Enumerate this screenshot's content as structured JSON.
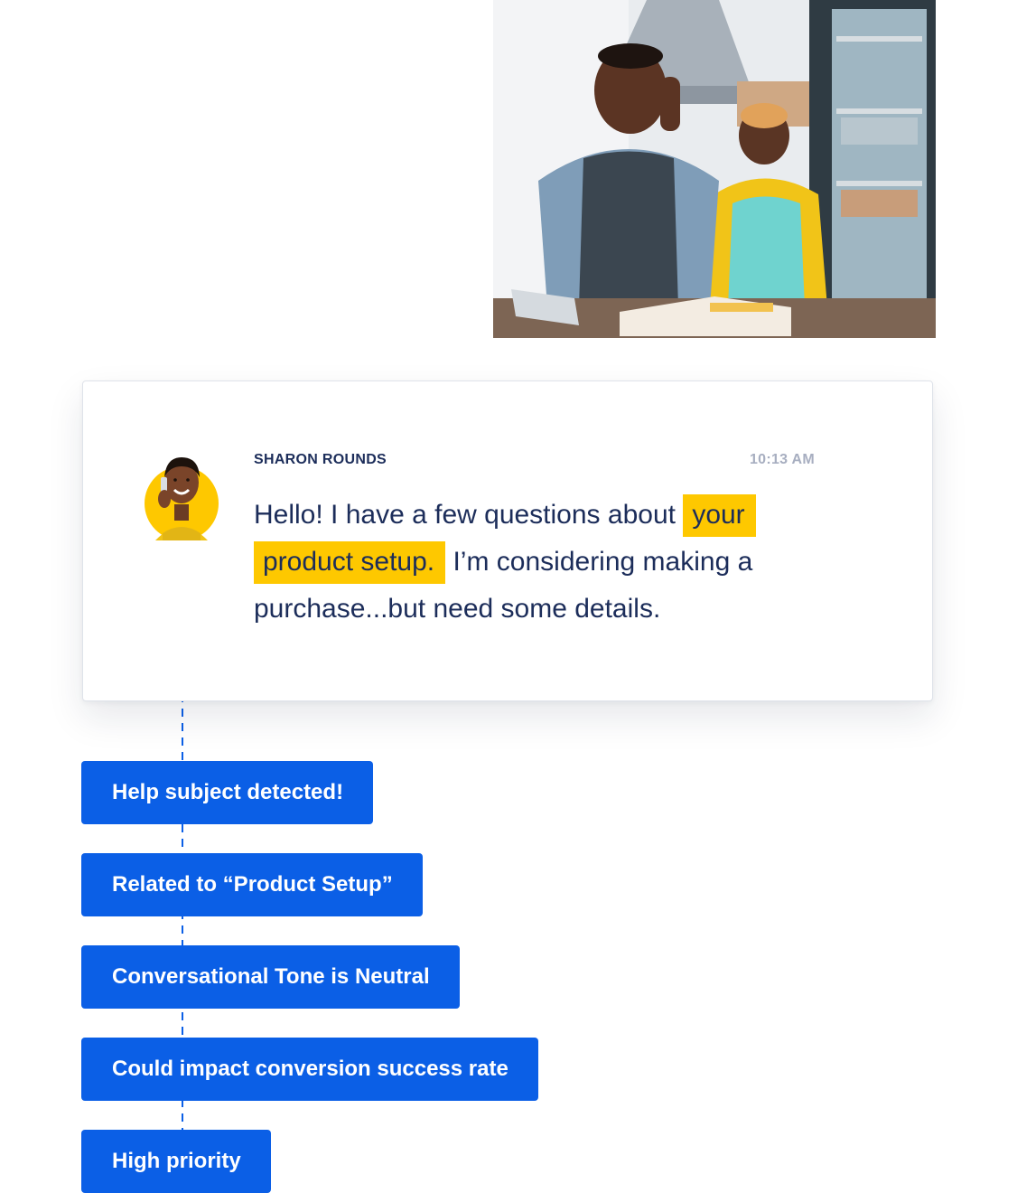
{
  "photo": {
    "icon": "cafe-workers-photo"
  },
  "message": {
    "sender": "SHARON ROUNDS",
    "time": "10:13 AM",
    "text_before": "Hello! I have a few questions about ",
    "highlight": "your product setup.",
    "text_after": " I’m considering making a purchase...but need some details.",
    "highlight_color": "#fec800"
  },
  "tags": [
    {
      "label": "Help subject detected!"
    },
    {
      "label": "Related to “Product Setup”"
    },
    {
      "label": "Conversational Tone is Neutral"
    },
    {
      "label": "Could impact conversion success rate"
    },
    {
      "label": "High priority"
    }
  ],
  "colors": {
    "tag_bg": "#0b5fe6",
    "text_primary": "#1c2d5a",
    "text_muted": "#a7aec0",
    "connector": "#0b5fe6"
  }
}
